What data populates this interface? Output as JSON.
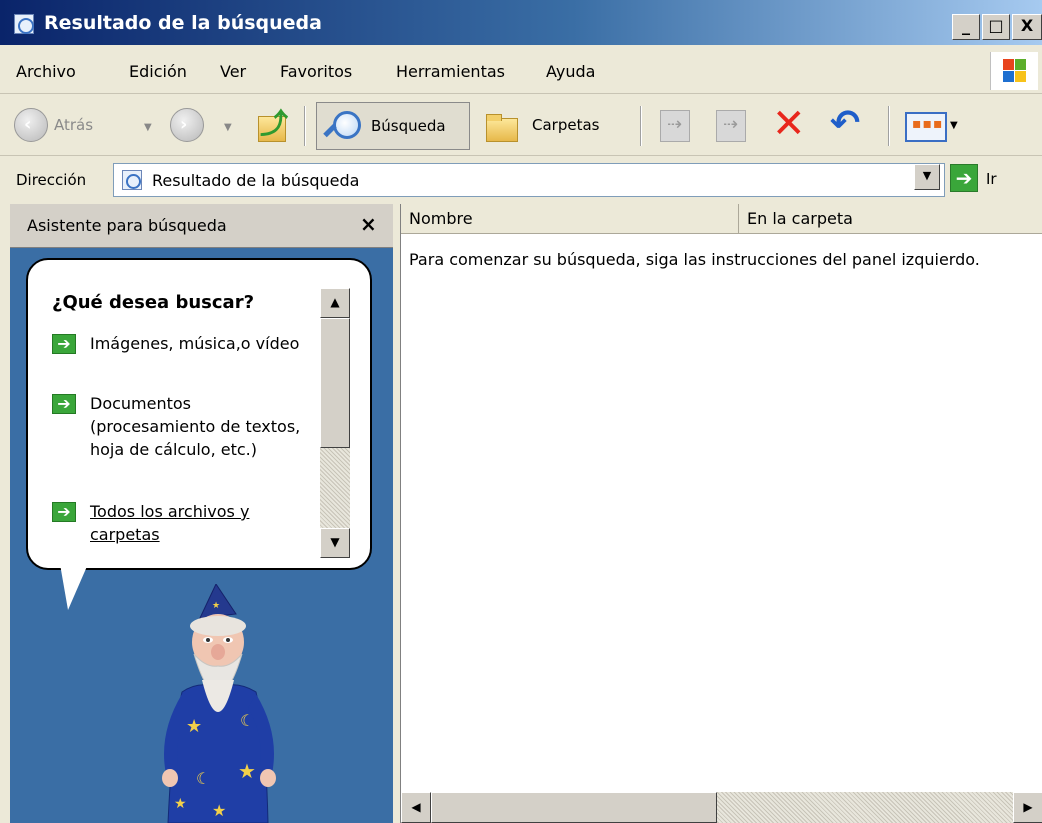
{
  "window": {
    "title": "Resultado de la búsqueda",
    "min_glyph": "_",
    "max_glyph": "□",
    "close_glyph": "X"
  },
  "menu": {
    "items": [
      "Archivo",
      "Edición",
      "Ver",
      "Favoritos",
      "Herramientas",
      "Ayuda"
    ]
  },
  "toolbar": {
    "back_label": "Atrás",
    "search_label": "Búsqueda",
    "folders_label": "Carpetas",
    "icons": [
      "back-icon",
      "forward-icon",
      "up-folder-icon",
      "search-icon",
      "folders-icon",
      "move-to-icon",
      "copy-to-icon",
      "delete-icon",
      "undo-icon",
      "views-icon"
    ],
    "delete_color": "#e8271c",
    "undo_color": "#1f5ec9"
  },
  "address": {
    "label": "Dirección",
    "value": "Resultado de la búsqueda",
    "go_label": "Ir"
  },
  "search_pane": {
    "title": "Asistente para búsqueda",
    "close_glyph": "×",
    "question": "¿Qué desea buscar?",
    "options": [
      "Imágenes, música,o vídeo",
      "Documentos (procesamiento de textos, hoja de cálculo, etc.)",
      "Todos los archivos y carpetas"
    ],
    "background_color": "#3a6ea5",
    "character": "wizard"
  },
  "results": {
    "columns": [
      "Nombre",
      "En la carpeta"
    ],
    "hint": "Para comenzar su búsqueda, siga las instrucciones del panel izquierdo."
  }
}
